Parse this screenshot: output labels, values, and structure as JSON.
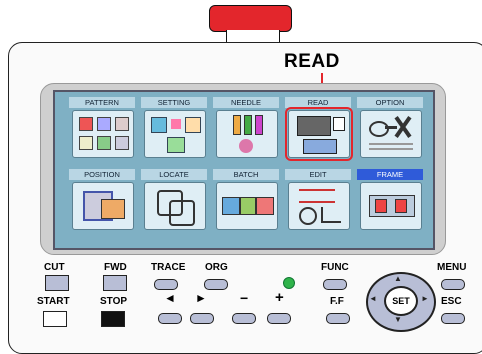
{
  "callout": "READ",
  "tiles": [
    {
      "label": "PATTERN"
    },
    {
      "label": "SETTING"
    },
    {
      "label": "NEEDLE"
    },
    {
      "label": "READ"
    },
    {
      "label": "OPTION"
    },
    {
      "label": "POSITION"
    },
    {
      "label": "LOCATE"
    },
    {
      "label": "BATCH"
    },
    {
      "label": "EDIT"
    },
    {
      "label": "FRAME"
    }
  ],
  "buttons": {
    "cut": "CUT",
    "fwd": "FWD",
    "trace": "TRACE",
    "org": "ORG",
    "func": "FUNC",
    "menu": "MENU",
    "start": "START",
    "stop": "STOP",
    "ff": "F.F",
    "esc": "ESC",
    "set": "SET",
    "left": "◄",
    "right": "►",
    "minus": "−",
    "plus": "+"
  },
  "colors": {
    "accent_red": "#e3262c",
    "led_green": "#2fb34a",
    "frame_blue": "#2f5bd9"
  }
}
